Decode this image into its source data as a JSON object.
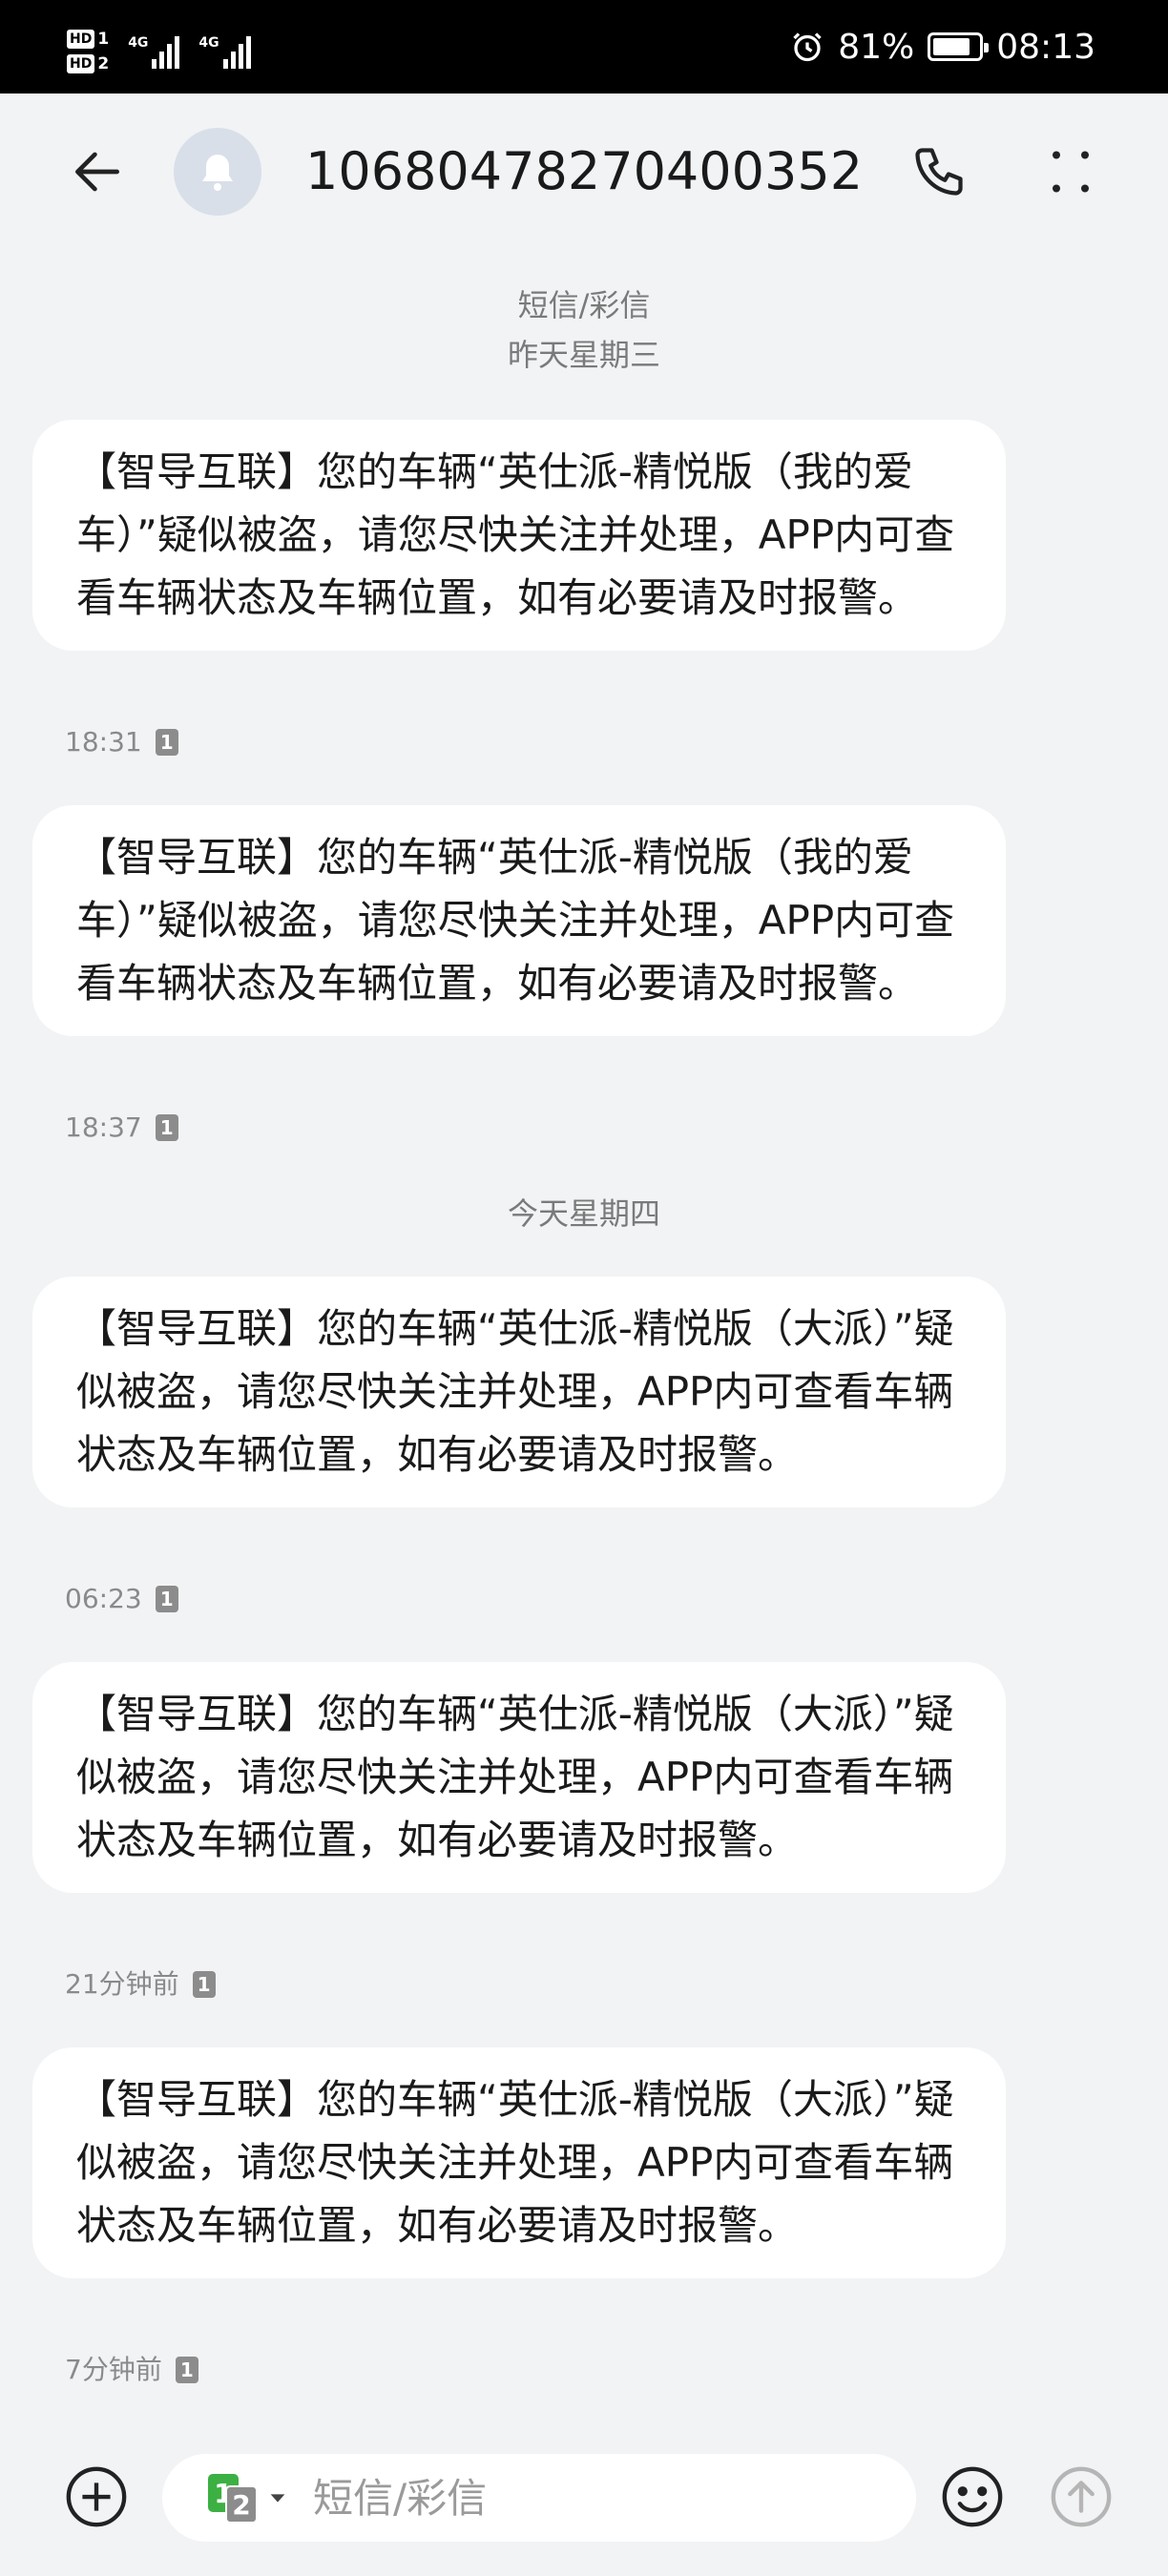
{
  "status_bar": {
    "sim1_label": "1",
    "sim2_label": "2",
    "hd_label": "HD",
    "network1": "4G",
    "network2": "4G",
    "battery_percent": "81%",
    "battery_level": 0.81,
    "time": "08:13",
    "alarm_icon": "alarm-clock-icon"
  },
  "header": {
    "contact": "10680478270400352",
    "avatar_icon": "bell-icon",
    "back_icon": "arrow-left-icon",
    "call_icon": "phone-icon",
    "more_icon": "more-vertical-icon"
  },
  "thread": {
    "channel_label": "短信/彩信",
    "separators": [
      "昨天星期三",
      "今天星期四"
    ],
    "messages": [
      {
        "text": "【智导互联】您的车辆“英仕派-精悦版（我的爱车）”疑似被盗，请您尽快关注并处理，APP内可查看车辆状态及车辆位置，如有必要请及时报警。",
        "time": "18:31",
        "sim": "1"
      },
      {
        "text": "【智导互联】您的车辆“英仕派-精悦版（我的爱车）”疑似被盗，请您尽快关注并处理，APP内可查看车辆状态及车辆位置，如有必要请及时报警。",
        "time": "18:37",
        "sim": "1"
      },
      {
        "text": "【智导互联】您的车辆“英仕派-精悦版（大派）”疑似被盗，请您尽快关注并处理，APP内可查看车辆状态及车辆位置，如有必要请及时报警。",
        "time": "06:23",
        "sim": "1"
      },
      {
        "text": "【智导互联】您的车辆“英仕派-精悦版（大派）”疑似被盗，请您尽快关注并处理，APP内可查看车辆状态及车辆位置，如有必要请及时报警。",
        "time": "21分钟前",
        "sim": "1"
      },
      {
        "text": "【智导互联】您的车辆“英仕派-精悦版（大派）”疑似被盗，请您尽快关注并处理，APP内可查看车辆状态及车辆位置，如有必要请及时报警。",
        "time": "7分钟前",
        "sim": "1"
      }
    ]
  },
  "composer": {
    "placeholder": "短信/彩信",
    "sim_primary": "1",
    "sim_secondary": "2",
    "add_icon": "plus-circle-icon",
    "emoji_icon": "smiley-icon",
    "send_icon": "send-arrow-icon"
  },
  "colors": {
    "background": "#f1f3f5",
    "bubble": "#ffffff",
    "sim_green": "#3cb043",
    "meta_text": "#8a8a8a"
  }
}
